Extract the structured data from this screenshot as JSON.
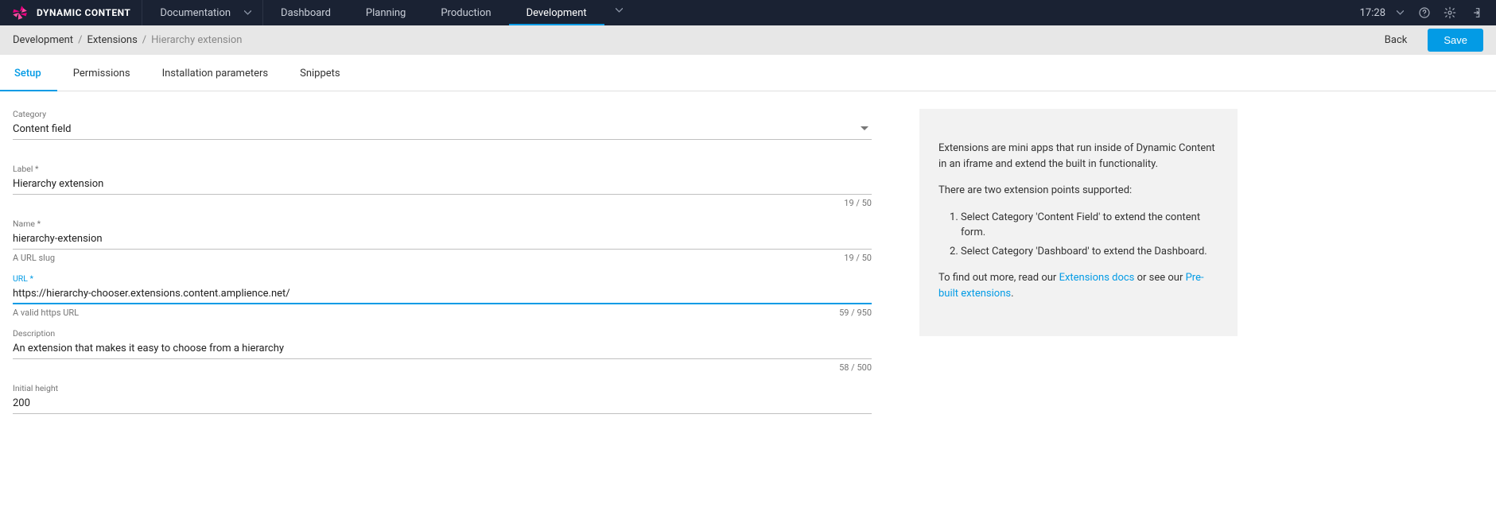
{
  "brand": "DYNAMIC CONTENT",
  "nav": {
    "docs": "Documentation",
    "dashboard": "Dashboard",
    "planning": "Planning",
    "production": "Production",
    "development": "Development"
  },
  "time": "17:28",
  "crumbs": {
    "a": "Development",
    "b": "Extensions",
    "c": "Hierarchy extension"
  },
  "actions": {
    "back": "Back",
    "save": "Save"
  },
  "tabs": {
    "setup": "Setup",
    "permissions": "Permissions",
    "install": "Installation parameters",
    "snippets": "Snippets"
  },
  "form": {
    "category": {
      "label": "Category",
      "value": "Content field"
    },
    "label": {
      "label": "Label *",
      "value": "Hierarchy extension",
      "counter": "19 / 50"
    },
    "name": {
      "label": "Name *",
      "value": "hierarchy-extension",
      "hint": "A URL slug",
      "counter": "19 / 50"
    },
    "url": {
      "label": "URL *",
      "value": "https://hierarchy-chooser.extensions.content.amplience.net/",
      "hint": "A valid https URL",
      "counter": "59 / 950"
    },
    "desc": {
      "label": "Description",
      "value": "An extension that makes it easy to choose from a hierarchy",
      "counter": "58 / 500"
    },
    "height": {
      "label": "Initial height",
      "value": "200"
    }
  },
  "side": {
    "p1": "Extensions are mini apps that run inside of Dynamic Content in an iframe and extend the built in functionality.",
    "p2": "There are two extension points supported:",
    "li1": "Select Category 'Content Field' to extend the content form.",
    "li2": "Select Category 'Dashboard' to extend the Dashboard.",
    "p3a": "To find out more, read our ",
    "link1": "Extensions docs",
    "p3b": " or see our ",
    "link2": "Pre-built extensions",
    "p3c": "."
  }
}
